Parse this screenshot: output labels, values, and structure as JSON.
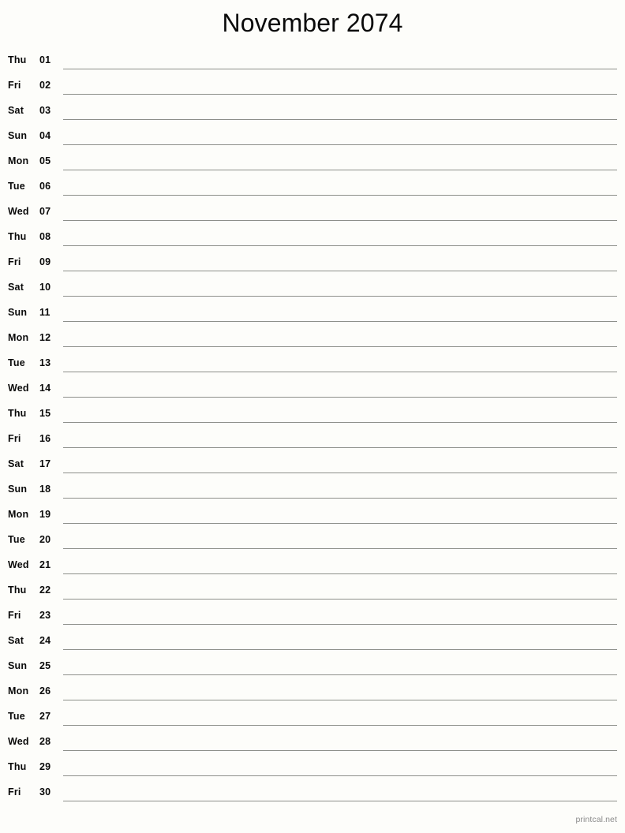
{
  "document": {
    "title": "November 2074",
    "month_name": "November",
    "year": "2074",
    "layout": "single-column-notes-list",
    "line_color": "#8d8f8a",
    "background_color": "#fdfdfa",
    "text_color": "#0a0a0a"
  },
  "footer": {
    "credit": "printcal.net",
    "color": "#8b8b8b"
  },
  "days": [
    {
      "weekday": "Thu",
      "date": "01"
    },
    {
      "weekday": "Fri",
      "date": "02"
    },
    {
      "weekday": "Sat",
      "date": "03"
    },
    {
      "weekday": "Sun",
      "date": "04"
    },
    {
      "weekday": "Mon",
      "date": "05"
    },
    {
      "weekday": "Tue",
      "date": "06"
    },
    {
      "weekday": "Wed",
      "date": "07"
    },
    {
      "weekday": "Thu",
      "date": "08"
    },
    {
      "weekday": "Fri",
      "date": "09"
    },
    {
      "weekday": "Sat",
      "date": "10"
    },
    {
      "weekday": "Sun",
      "date": "11"
    },
    {
      "weekday": "Mon",
      "date": "12"
    },
    {
      "weekday": "Tue",
      "date": "13"
    },
    {
      "weekday": "Wed",
      "date": "14"
    },
    {
      "weekday": "Thu",
      "date": "15"
    },
    {
      "weekday": "Fri",
      "date": "16"
    },
    {
      "weekday": "Sat",
      "date": "17"
    },
    {
      "weekday": "Sun",
      "date": "18"
    },
    {
      "weekday": "Mon",
      "date": "19"
    },
    {
      "weekday": "Tue",
      "date": "20"
    },
    {
      "weekday": "Wed",
      "date": "21"
    },
    {
      "weekday": "Thu",
      "date": "22"
    },
    {
      "weekday": "Fri",
      "date": "23"
    },
    {
      "weekday": "Sat",
      "date": "24"
    },
    {
      "weekday": "Sun",
      "date": "25"
    },
    {
      "weekday": "Mon",
      "date": "26"
    },
    {
      "weekday": "Tue",
      "date": "27"
    },
    {
      "weekday": "Wed",
      "date": "28"
    },
    {
      "weekday": "Thu",
      "date": "29"
    },
    {
      "weekday": "Fri",
      "date": "30"
    }
  ]
}
